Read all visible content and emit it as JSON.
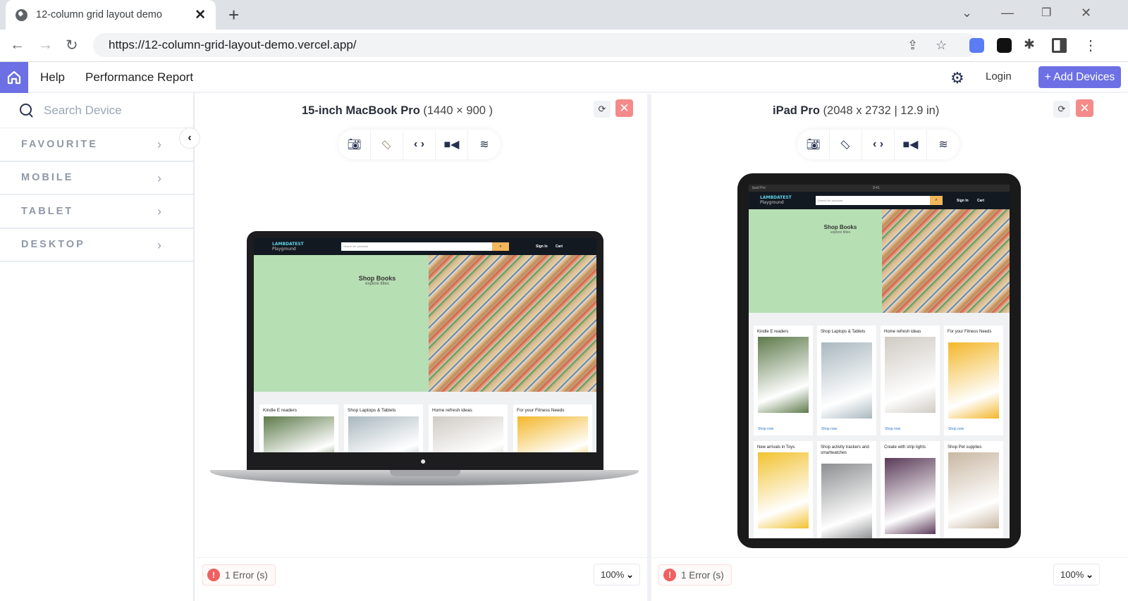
{
  "browser": {
    "tab_title": "12-column grid layout demo",
    "url": "https://12-column-grid-layout-demo.vercel.app/",
    "new_tab_label": "+",
    "icons": [
      "globe-icon",
      "close-icon",
      "back-icon",
      "forward-icon",
      "reload-icon",
      "share-icon",
      "star-icon",
      "extension-icon",
      "puzzle-icon",
      "sidepanel-icon",
      "menu-icon"
    ]
  },
  "appbar": {
    "help": "Help",
    "performance_report": "Performance Report",
    "login": "Login",
    "add_devices": "+ Add Devices"
  },
  "sidebar": {
    "search_placeholder": "Search Device",
    "categories": [
      {
        "label": "FAVOURITE"
      },
      {
        "label": "MOBILE"
      },
      {
        "label": "TABLET"
      },
      {
        "label": "DESKTOP"
      }
    ]
  },
  "panels": [
    {
      "device_name": "15-inch MacBook Pro",
      "device_spec": "(1440 × 900 )",
      "error_text": "1 Error (s)",
      "zoom_value": "100%"
    },
    {
      "device_name": "iPad Pro",
      "device_spec": "(2048 x 2732 | 12.9 in)",
      "error_text": "1 Error (s)",
      "zoom_value": "100%"
    }
  ],
  "site": {
    "logo": "LAMBDATEST",
    "logo_sub": "Playground",
    "search_placeholder": "Search for products",
    "sign_in": "Sign In",
    "cart": "Cart",
    "hero_title": "Shop Books",
    "hero_sub": "explore titles",
    "shop_now": "Shop now",
    "status_left": "Ipad Pro",
    "status_time": "9:41",
    "cards": [
      {
        "title": "Kindle E readers",
        "color": "#5d7a4a"
      },
      {
        "title": "Shop Laptops & Tablets",
        "color": "#a9b8bf"
      },
      {
        "title": "Home refresh ideas",
        "color": "#cfcac3"
      },
      {
        "title": "For your Fitness Needs",
        "color": "#f3b72a"
      },
      {
        "title": "New arrivals in Toys",
        "color": "#f2c230"
      },
      {
        "title": "Shop activity trackers and smartwatches",
        "color": "#8d8e90"
      },
      {
        "title": "Create with strip lights",
        "color": "#5a3a58"
      },
      {
        "title": "Shop Pet supplies",
        "color": "#c9b7a2"
      }
    ]
  }
}
